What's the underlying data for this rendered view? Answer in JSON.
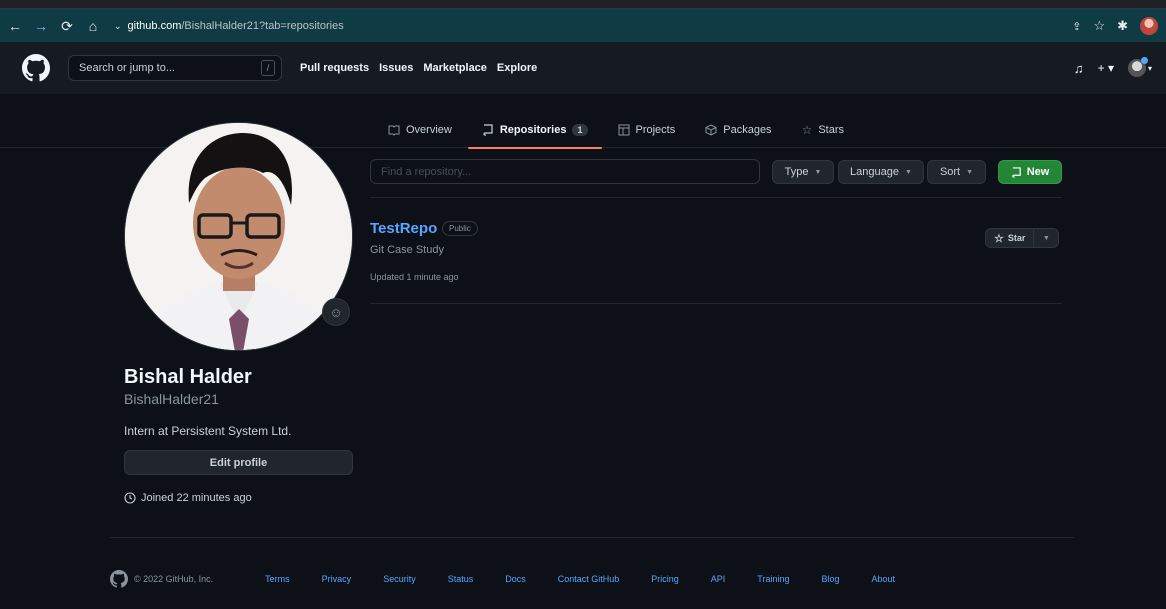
{
  "browser": {
    "url_host": "github.com",
    "url_path": "/BishalHalder21?tab=repositories"
  },
  "header": {
    "search_placeholder": "Search or jump to...",
    "search_key": "/",
    "nav": [
      "Pull requests",
      "Issues",
      "Marketplace",
      "Explore"
    ]
  },
  "tabs": [
    {
      "label": "Overview",
      "icon": "book-icon"
    },
    {
      "label": "Repositories",
      "icon": "repo-icon",
      "count": "1",
      "active": true
    },
    {
      "label": "Projects",
      "icon": "table-icon"
    },
    {
      "label": "Packages",
      "icon": "package-icon"
    },
    {
      "label": "Stars",
      "icon": "star-icon"
    }
  ],
  "profile": {
    "name": "Bishal Halder",
    "login": "BishalHalder21",
    "bio": "Intern at Persistent System Ltd.",
    "edit_label": "Edit profile",
    "joined": "Joined 22 minutes ago"
  },
  "repos_toolbar": {
    "find_placeholder": "Find a repository...",
    "type_label": "Type",
    "language_label": "Language",
    "sort_label": "Sort",
    "new_label": "New"
  },
  "repo": {
    "name": "TestRepo",
    "visibility": "Public",
    "description": "Git Case Study",
    "updated": "Updated 1 minute ago",
    "star_label": "Star"
  },
  "footer": {
    "copyright": "© 2022 GitHub, Inc.",
    "links": [
      "Terms",
      "Privacy",
      "Security",
      "Status",
      "Docs",
      "Contact GitHub",
      "Pricing",
      "API",
      "Training",
      "Blog",
      "About"
    ]
  },
  "colors": {
    "accent_blue": "#58a6ff",
    "active_tab_underline": "#f78166",
    "new_button": "#238636"
  }
}
